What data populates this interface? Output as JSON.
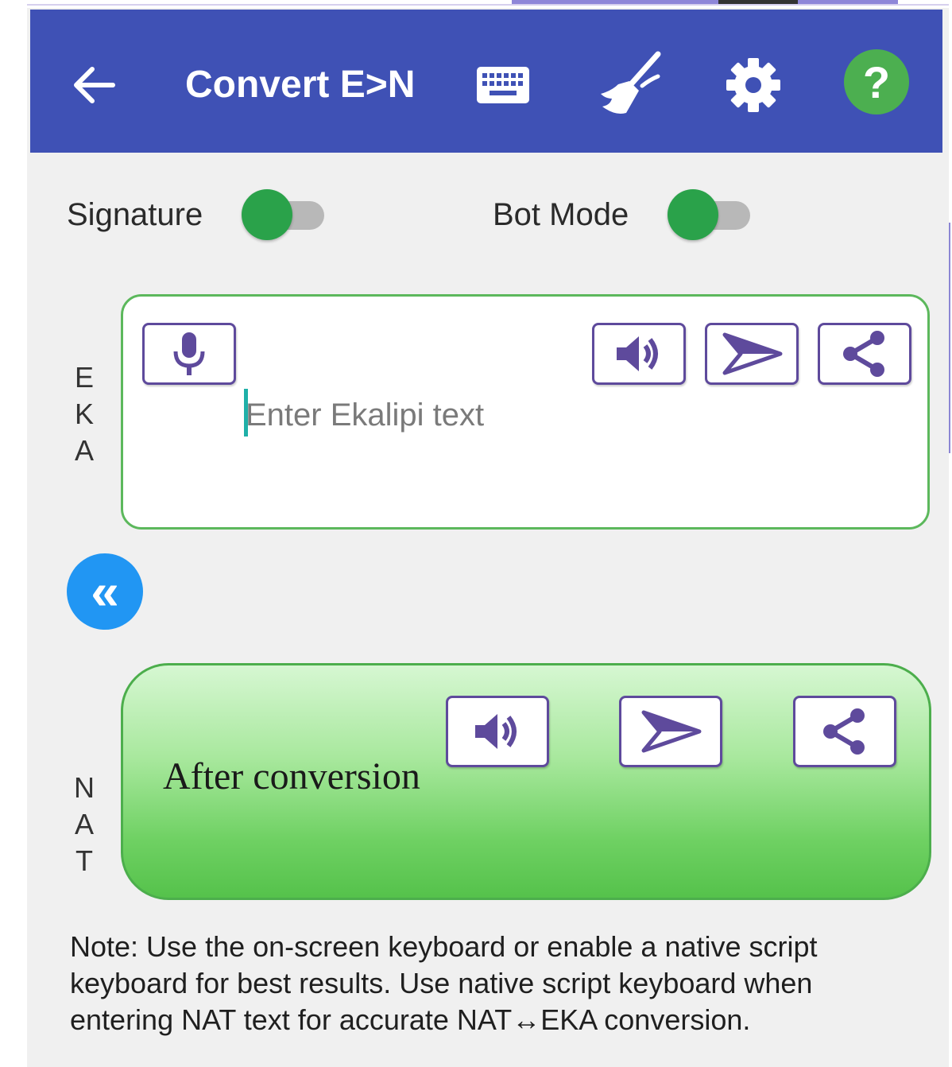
{
  "colors": {
    "app_bar": "#3f51b5",
    "help_button": "#4caf50",
    "toggle_thumb": "#2aa24a",
    "icon_button_border": "#5e4a9c",
    "swap_button": "#2196f3",
    "input_border": "#5cb85c",
    "output_gradient_top": "#d6f7d2",
    "output_gradient_bottom": "#55c24b"
  },
  "app_bar": {
    "title": "Convert E>N",
    "icons": [
      "back-arrow-icon",
      "keyboard-icon",
      "broom-icon",
      "gear-icon",
      "help-icon"
    ],
    "help_label": "?"
  },
  "toggles": {
    "signature": {
      "label": "Signature",
      "on": true
    },
    "bot_mode": {
      "label": "Bot Mode",
      "on": true
    }
  },
  "input": {
    "side_label": [
      "E",
      "K",
      "A"
    ],
    "placeholder": "Enter Ekalipi text",
    "value": "",
    "icons": [
      "microphone-icon",
      "speaker-icon",
      "send-icon",
      "share-icon"
    ]
  },
  "swap_button": {
    "glyph": "«",
    "icon": "double-chevron-left-icon"
  },
  "output": {
    "side_label": [
      "N",
      "A",
      "T"
    ],
    "text": "After conversion",
    "icons": [
      "speaker-icon",
      "send-icon",
      "share-icon"
    ]
  },
  "note": "Note: Use the on-screen keyboard or enable a native script keyboard for best results. Use native script keyboard when entering NAT text for accurate NAT↔EKA conversion."
}
